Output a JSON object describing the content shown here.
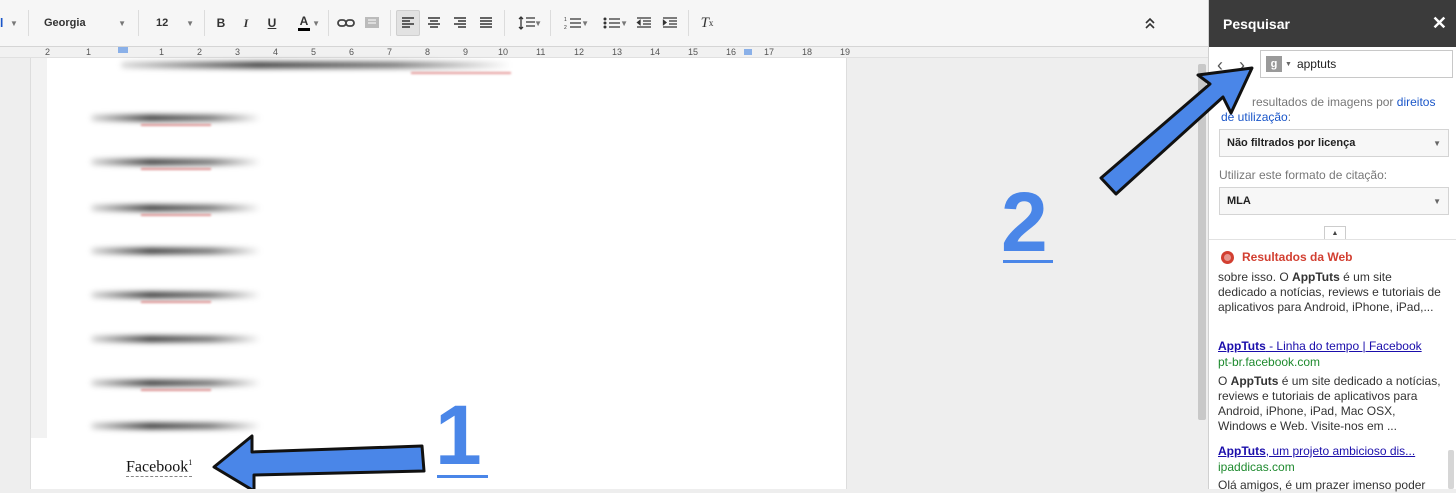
{
  "toolbar": {
    "font_name": "Georgia",
    "font_size": "12",
    "bold": "B",
    "italic": "I",
    "underline": "U",
    "text_color": "A",
    "clear_format": "T",
    "collapse_glyph": "⌃"
  },
  "ruler": {
    "ticks": [
      "2",
      "1",
      "1",
      "2",
      "3",
      "4",
      "5",
      "6",
      "7",
      "8",
      "9",
      "10",
      "11",
      "12",
      "13",
      "14",
      "15",
      "16",
      "17",
      "18",
      "19"
    ]
  },
  "document": {
    "facebook_word": "Facebook",
    "footnote_mark": "1"
  },
  "panel": {
    "title": "Pesquisar",
    "close": "✕",
    "search_value": "apptuts",
    "g_icon": "g",
    "filter_text_1": "resultados de imagens por",
    "filter_link_1": "direitos",
    "filter_link_2": "de utilização",
    "filter_colon": ":",
    "license_option": "Não filtrados por licença",
    "citation_label": "Utilizar este formato de citação:",
    "citation_option": "MLA",
    "web_results_title": "Resultados da Web",
    "results": [
      {
        "snippet_prefix": "sobre isso. O ",
        "snippet_bold": "AppTuts",
        "snippet_rest": " é um site dedicado a notícias, reviews e tutoriais de aplicativos para Android, iPhone, iPad,..."
      },
      {
        "link_bold": "AppTuts",
        "link_rest": " - Linha do tempo | Facebook",
        "url": "pt-br.facebook.com",
        "snippet_prefix": "O ",
        "snippet_bold": "AppTuts",
        "snippet_rest": " é um site dedicado a notícias, reviews e tutoriais de aplicativos para Android, iPhone, iPad, Mac OSX, Windows e Web. Visite-nos em ..."
      },
      {
        "link_bold": "AppTuts",
        "link_rest": ", um projeto ambicioso dis...",
        "url": "ipaddicas.com",
        "snippet": "Olá amigos, é um prazer imenso poder"
      }
    ]
  },
  "annotations": {
    "one": "1",
    "two": "2"
  },
  "colors": {
    "annotation_blue": "#4a86e8",
    "panel_header": "#3b3b3b",
    "web_results_red": "#d23f31",
    "link_blue": "#1a0dab",
    "url_green": "#1e8a2e"
  }
}
